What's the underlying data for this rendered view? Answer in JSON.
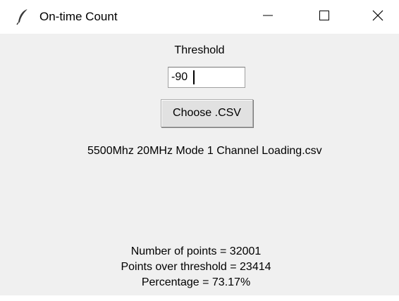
{
  "window": {
    "title": "On-time Count",
    "icon": "feather-icon",
    "controls": {
      "minimize_icon": "minimize-icon",
      "maximize_icon": "maximize-icon",
      "close_icon": "close-icon"
    }
  },
  "form": {
    "threshold_label": "Threshold",
    "threshold_value": "-90",
    "choose_button_label": "Choose .CSV",
    "selected_file": "5500Mhz 20MHz Mode 1 Channel Loading.csv"
  },
  "results": {
    "points_line": "Number of points = 32001",
    "over_line": "Points over threshold = 23414",
    "percentage_line": "Percentage = 73.17%"
  },
  "colors": {
    "window_bg": "#f0f0f0",
    "titlebar_bg": "#ffffff",
    "button_bg": "#e1e1e1"
  }
}
